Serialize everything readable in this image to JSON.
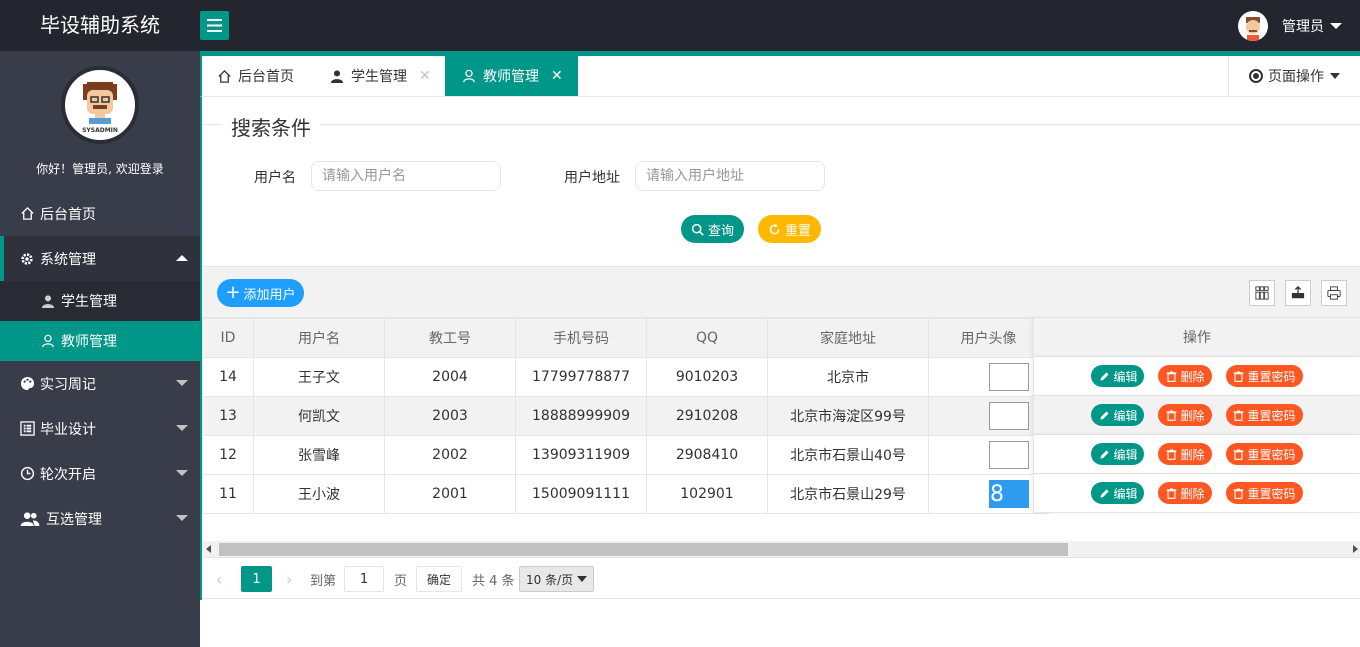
{
  "app": {
    "title": "毕设辅助系统"
  },
  "header": {
    "user_name": "管理员"
  },
  "sidebar": {
    "welcome": "你好！管理员, 欢迎登录",
    "avatar_text": "SYSADMIN",
    "items": [
      {
        "label": "后台首页",
        "icon": "home-icon"
      },
      {
        "label": "系统管理",
        "icon": "gear-icon"
      },
      {
        "label": "学生管理",
        "icon": "user-icon"
      },
      {
        "label": "教师管理",
        "icon": "user-outline-icon"
      },
      {
        "label": "实习周记",
        "icon": "palette-icon"
      },
      {
        "label": "毕业设计",
        "icon": "list-icon"
      },
      {
        "label": "轮次开启",
        "icon": "clock-icon"
      },
      {
        "label": "互选管理",
        "icon": "group-icon"
      }
    ]
  },
  "tabs": [
    {
      "label": "后台首页"
    },
    {
      "label": "学生管理"
    },
    {
      "label": "教师管理"
    }
  ],
  "page_ops": {
    "label": "页面操作"
  },
  "search": {
    "legend": "搜索条件",
    "username_label": "用户名",
    "username_placeholder": "请输入用户名",
    "address_label": "用户地址",
    "address_placeholder": "请输入用户地址",
    "query_label": "查询",
    "reset_label": "重置"
  },
  "toolbar": {
    "add_label": "添加用户"
  },
  "table": {
    "columns": [
      "ID",
      "用户名",
      "教工号",
      "手机号码",
      "QQ",
      "家庭地址",
      "用户头像",
      "操作"
    ],
    "rows": [
      {
        "id": "14",
        "name": "王子文",
        "no": "2004",
        "phone": "17799778877",
        "qq": "9010203",
        "addr": "北京市"
      },
      {
        "id": "13",
        "name": "何凯文",
        "no": "2003",
        "phone": "18888999909",
        "qq": "2910208",
        "addr": "北京市海淀区99号"
      },
      {
        "id": "12",
        "name": "张雪峰",
        "no": "2002",
        "phone": "13909311909",
        "qq": "2908410",
        "addr": "北京市石景山40号"
      },
      {
        "id": "11",
        "name": "王小波",
        "no": "2001",
        "phone": "15009091111",
        "qq": "102901",
        "addr": "北京市石景山29号"
      }
    ],
    "avatar_glyph": "8",
    "actions": {
      "edit": "编辑",
      "delete": "删除",
      "reset_pwd": "重置密码"
    }
  },
  "pager": {
    "current": "1",
    "goto_label": "到第",
    "page_input": "1",
    "page_unit": "页",
    "confirm": "确定",
    "total": "共 4 条",
    "page_size": "10 条/页"
  },
  "colors": {
    "primary": "#009688",
    "danger": "#ff5722",
    "info": "#1e9fff",
    "warn": "#ffb800"
  }
}
